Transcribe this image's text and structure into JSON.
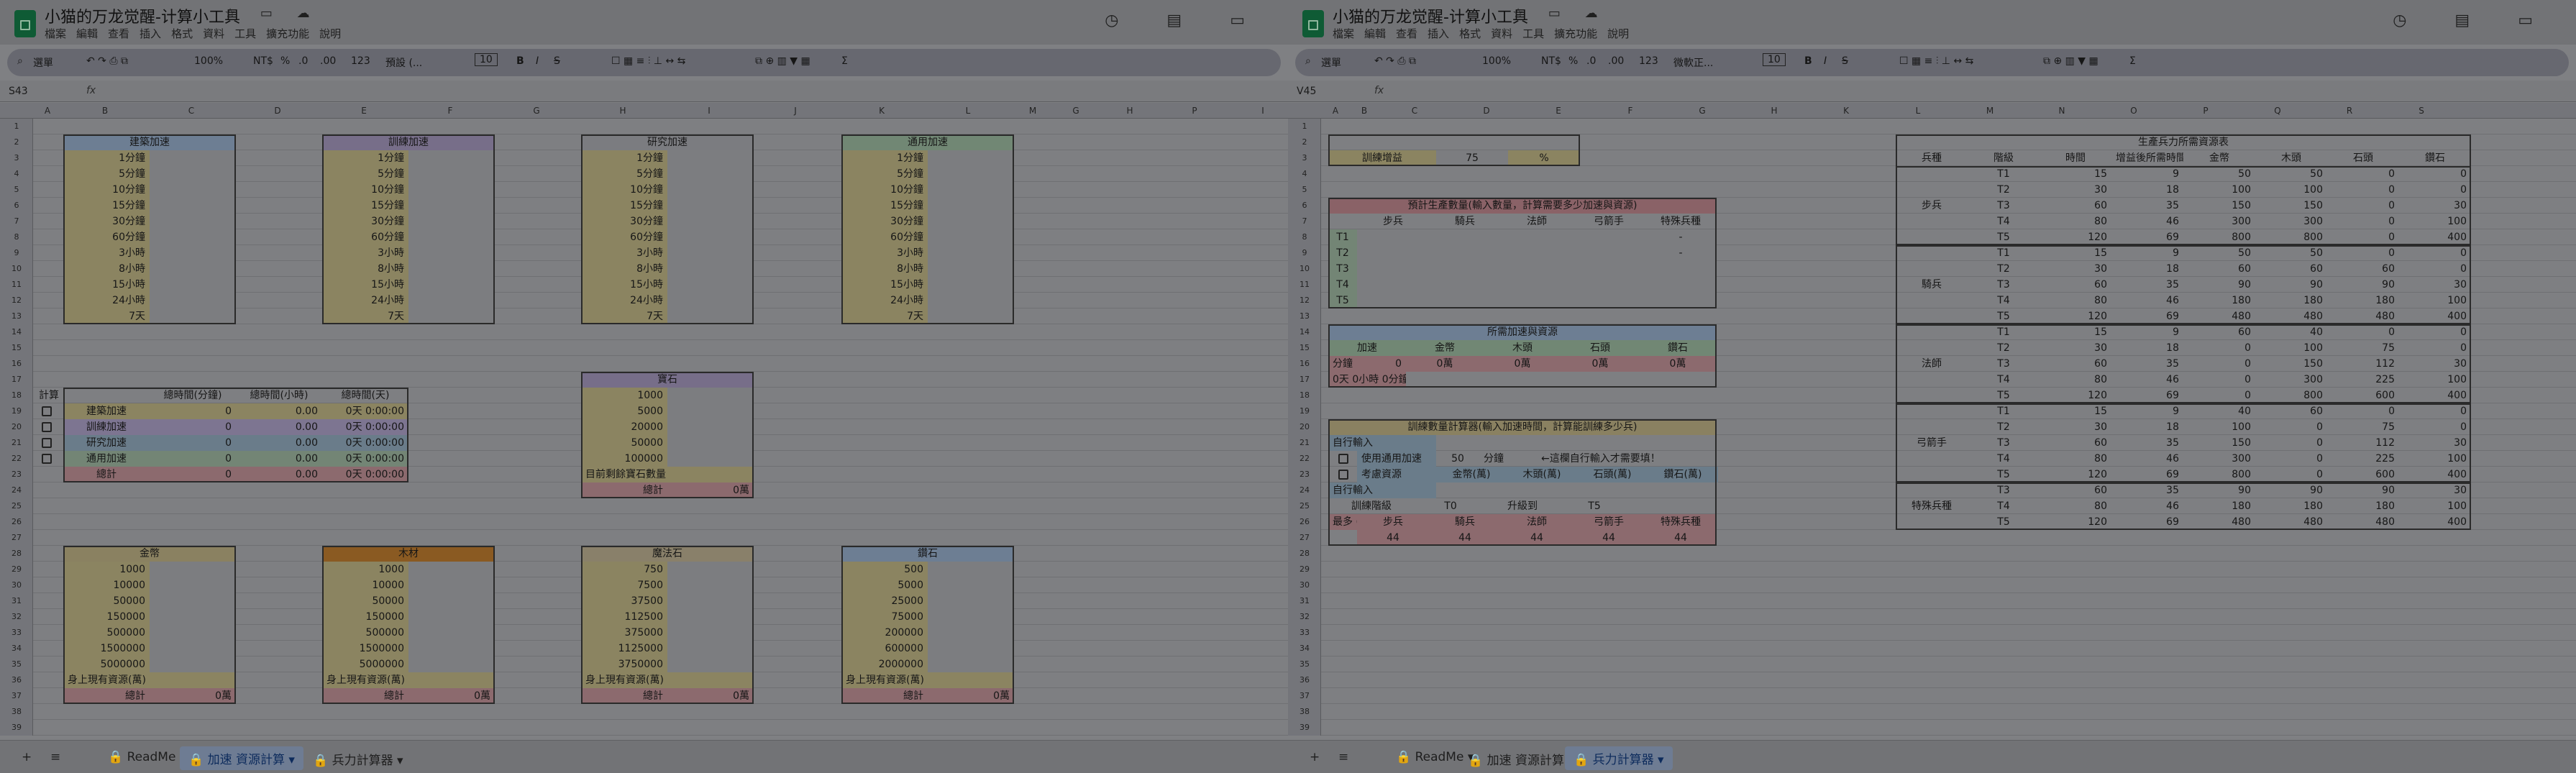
{
  "app": {
    "title": "小猫的万龙觉醒-计算小工具",
    "menu": [
      "檔案",
      "編輯",
      "查看",
      "插入",
      "格式",
      "資料",
      "工具",
      "擴充功能",
      "說明"
    ]
  },
  "toolbar": {
    "search": "選單",
    "zoom": "100%",
    "currency": "NT$",
    "pct": "%",
    "dec0": ".0",
    "dec00": ".00",
    "fmt123": "123",
    "font1": "預設 (...",
    "font2": "微軟正...",
    "size": "10",
    "sum": "Σ"
  },
  "left": {
    "cellref": "S43",
    "cols": [
      "A",
      "B",
      "C",
      "D",
      "E",
      "F",
      "G",
      "H",
      "I",
      "J",
      "K",
      "L",
      "M",
      "G",
      "H",
      "P",
      "I"
    ],
    "speed": {
      "headers": [
        "建築加速",
        "訓練加速",
        "研究加速",
        "通用加速"
      ],
      "items": [
        "1分鐘",
        "5分鐘",
        "10分鐘",
        "15分鐘",
        "30分鐘",
        "60分鐘",
        "3小時",
        "8小時",
        "15小時",
        "24小時",
        "7天"
      ]
    },
    "calc": {
      "label": "計算",
      "headers": [
        "總時間(分鐘)",
        "總時間(小時)",
        "總時間(天)"
      ],
      "rows": [
        {
          "name": "建築加速",
          "m": "0",
          "h": "0.00",
          "d": "0天 0:00:00"
        },
        {
          "name": "訓練加速",
          "m": "0",
          "h": "0.00",
          "d": "0天 0:00:00"
        },
        {
          "name": "研究加速",
          "m": "0",
          "h": "0.00",
          "d": "0天 0:00:00"
        },
        {
          "name": "通用加速",
          "m": "0",
          "h": "0.00",
          "d": "0天 0:00:00"
        }
      ],
      "total": {
        "name": "總計",
        "m": "0",
        "h": "0.00",
        "d": "0天 0:00:00"
      }
    },
    "gems": {
      "header": "寶石",
      "values": [
        "1000",
        "5000",
        "20000",
        "50000",
        "100000"
      ],
      "note": "目前剩餘寶石數量",
      "total_label": "總計",
      "total": "0萬"
    },
    "res": [
      {
        "header": "金幣",
        "values": [
          "1000",
          "10000",
          "50000",
          "150000",
          "500000",
          "1500000",
          "5000000"
        ]
      },
      {
        "header": "木材",
        "values": [
          "1000",
          "10000",
          "50000",
          "150000",
          "500000",
          "1500000",
          "5000000"
        ]
      },
      {
        "header": "魔法石",
        "values": [
          "750",
          "7500",
          "37500",
          "112500",
          "375000",
          "1125000",
          "3750000"
        ]
      },
      {
        "header": "鑽石",
        "values": [
          "500",
          "5000",
          "25000",
          "75000",
          "200000",
          "600000",
          "2000000"
        ]
      }
    ],
    "res_note": "身上現有資源(萬)",
    "res_total_label": "總計",
    "res_total": "0萬",
    "tabs": [
      "ReadMe",
      "加速 資源計算",
      "兵力計算器"
    ]
  },
  "right": {
    "cellref": "V45",
    "cols": [
      "A",
      "B",
      "C",
      "D",
      "E",
      "F",
      "G",
      "H",
      "K",
      "L",
      "M",
      "N",
      "O",
      "P",
      "Q",
      "R",
      "S"
    ],
    "bonus": {
      "label": "訓練增益",
      "value": "75",
      "unit": "%"
    },
    "prod": {
      "title": "預計生產數量(輸入數量，計算需要多少加速與資源)",
      "cols": [
        "步兵",
        "騎兵",
        "法師",
        "弓箭手",
        "特殊兵種"
      ],
      "tiers": [
        "T1",
        "T2",
        "T3",
        "T4",
        "T5"
      ],
      "dash1": "-",
      "dash2": "-"
    },
    "need": {
      "title": "所需加速與資源",
      "cols": [
        "加速",
        "金幣",
        "木頭",
        "石頭",
        "鑽石"
      ],
      "speed_label": "分鐘",
      "speed_val": "0",
      "time1": "0天 0小時 0分鐘",
      "vals": [
        "0萬",
        "0萬",
        "0萬",
        "0萬"
      ]
    },
    "train": {
      "title": "訓練數量計算器(輸入加速時間，計算能訓練多少兵)",
      "custom": "自行輸入",
      "minutes": "50",
      "unit": "分鐘",
      "hint": "←這欄自行輸入才需要填！",
      "opt1": "使用通用加速",
      "opt2": "考慮資源",
      "res_cols": [
        "金幣(萬)",
        "木頭(萬)",
        "石頭(萬)",
        "鑽石(萬)"
      ],
      "custom2": "自行輸入",
      "tier_label": "訓練階級",
      "tier_from": "T0",
      "upgrade": "升級到",
      "tier_to": "T5",
      "max_label": "最多\n(單兵種)",
      "cols": [
        "步兵",
        "騎兵",
        "法師",
        "弓箭手",
        "特殊兵種"
      ],
      "vals": [
        "44",
        "44",
        "44",
        "44",
        "44"
      ]
    },
    "table": {
      "title": "生產兵力所需資源表",
      "headers": [
        "兵種",
        "階級",
        "時間",
        "增益後所需時間",
        "金幣",
        "木頭",
        "石頭",
        "鑽石"
      ],
      "groups": [
        {
          "name": "步兵",
          "rows": [
            [
              "T1",
              "15",
              "9",
              "50",
              "50",
              "0",
              "0"
            ],
            [
              "T2",
              "30",
              "18",
              "100",
              "100",
              "0",
              "0"
            ],
            [
              "T3",
              "60",
              "35",
              "150",
              "150",
              "0",
              "30"
            ],
            [
              "T4",
              "80",
              "46",
              "300",
              "300",
              "0",
              "100"
            ],
            [
              "T5",
              "120",
              "69",
              "800",
              "800",
              "0",
              "400"
            ]
          ]
        },
        {
          "name": "騎兵",
          "rows": [
            [
              "T1",
              "15",
              "9",
              "50",
              "50",
              "0",
              "0"
            ],
            [
              "T2",
              "30",
              "18",
              "60",
              "60",
              "60",
              "0"
            ],
            [
              "T3",
              "60",
              "35",
              "90",
              "90",
              "90",
              "30"
            ],
            [
              "T4",
              "80",
              "46",
              "180",
              "180",
              "180",
              "100"
            ],
            [
              "T5",
              "120",
              "69",
              "480",
              "480",
              "480",
              "400"
            ]
          ]
        },
        {
          "name": "法師",
          "rows": [
            [
              "T1",
              "15",
              "9",
              "60",
              "40",
              "0",
              "0"
            ],
            [
              "T2",
              "30",
              "18",
              "0",
              "100",
              "75",
              "0"
            ],
            [
              "T3",
              "60",
              "35",
              "0",
              "150",
              "112",
              "30"
            ],
            [
              "T4",
              "80",
              "46",
              "0",
              "300",
              "225",
              "100"
            ],
            [
              "T5",
              "120",
              "69",
              "0",
              "800",
              "600",
              "400"
            ]
          ]
        },
        {
          "name": "弓箭手",
          "rows": [
            [
              "T1",
              "15",
              "9",
              "40",
              "60",
              "0",
              "0"
            ],
            [
              "T2",
              "30",
              "18",
              "100",
              "0",
              "75",
              "0"
            ],
            [
              "T3",
              "60",
              "35",
              "150",
              "0",
              "112",
              "30"
            ],
            [
              "T4",
              "80",
              "46",
              "300",
              "0",
              "225",
              "100"
            ],
            [
              "T5",
              "120",
              "69",
              "800",
              "0",
              "600",
              "400"
            ]
          ]
        },
        {
          "name": "特殊兵種",
          "rows": [
            [
              "T3",
              "60",
              "35",
              "90",
              "90",
              "90",
              "30"
            ],
            [
              "T4",
              "80",
              "46",
              "180",
              "180",
              "180",
              "100"
            ],
            [
              "T5",
              "120",
              "69",
              "480",
              "480",
              "480",
              "400"
            ]
          ]
        }
      ]
    },
    "tabs": [
      "ReadMe",
      "加速 資源計算",
      "兵力計算器"
    ]
  }
}
